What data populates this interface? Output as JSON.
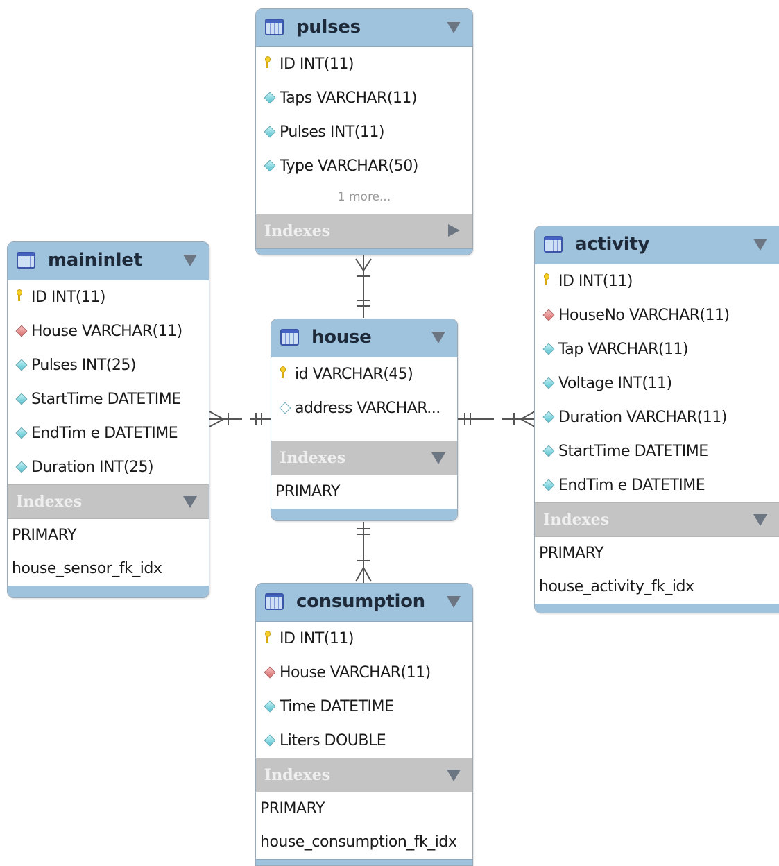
{
  "tables": {
    "pulses": {
      "name": "pulses",
      "columns": [
        {
          "text": "ID INT(11)",
          "icon": "primary-key-icon"
        },
        {
          "text": "Taps VARCHAR(11)",
          "icon": "column-diamond-icon"
        },
        {
          "text": "Pulses INT(11)",
          "icon": "column-diamond-icon"
        },
        {
          "text": "Type VARCHAR(50)",
          "icon": "column-diamond-icon"
        }
      ],
      "more": "1 more...",
      "indexes_label": "Indexes"
    },
    "maininlet": {
      "name": "maininlet",
      "columns": [
        {
          "text": "ID INT(11)",
          "icon": "primary-key-icon"
        },
        {
          "text": "House VARCHAR(11)",
          "icon": "foreign-key-diamond-icon"
        },
        {
          "text": "Pulses INT(25)",
          "icon": "column-diamond-icon"
        },
        {
          "text": "StartTime DATETIME",
          "icon": "column-diamond-icon"
        },
        {
          "text": "EndTim e DATETIME",
          "icon": "column-diamond-icon"
        },
        {
          "text": "Duration INT(25)",
          "icon": "column-diamond-icon"
        }
      ],
      "indexes_label": "Indexes",
      "indexes": [
        "PRIMARY",
        "house_sensor_fk_idx"
      ]
    },
    "house": {
      "name": "house",
      "columns": [
        {
          "text": "id VARCHAR(45)",
          "icon": "primary-key-icon"
        },
        {
          "text": "address VARCHAR...",
          "icon": "nullable-column-diamond-icon"
        }
      ],
      "indexes_label": "Indexes",
      "indexes": [
        "PRIMARY"
      ]
    },
    "activity": {
      "name": "activity",
      "columns": [
        {
          "text": "ID INT(11)",
          "icon": "primary-key-icon"
        },
        {
          "text": "HouseNo VARCHAR(11)",
          "icon": "foreign-key-diamond-icon"
        },
        {
          "text": "Tap VARCHAR(11)",
          "icon": "column-diamond-icon"
        },
        {
          "text": "Voltage INT(11)",
          "icon": "column-diamond-icon"
        },
        {
          "text": "Duration VARCHAR(11)",
          "icon": "column-diamond-icon"
        },
        {
          "text": "StartTime DATETIME",
          "icon": "column-diamond-icon"
        },
        {
          "text": "EndTim e DATETIME",
          "icon": "column-diamond-icon"
        }
      ],
      "indexes_label": "Indexes",
      "indexes": [
        "PRIMARY",
        "house_activity_fk_idx"
      ]
    },
    "consumption": {
      "name": "consumption",
      "columns": [
        {
          "text": "ID INT(11)",
          "icon": "primary-key-icon"
        },
        {
          "text": "House VARCHAR(11)",
          "icon": "foreign-key-diamond-icon"
        },
        {
          "text": "Time DATETIME",
          "icon": "column-diamond-icon"
        },
        {
          "text": "Liters DOUBLE",
          "icon": "column-diamond-icon"
        }
      ],
      "indexes_label": "Indexes",
      "indexes": [
        "PRIMARY",
        "house_consumption_fk_idx"
      ]
    }
  },
  "relationships": [
    {
      "from": "house",
      "to": "pulses",
      "cardinality": "one-to-many"
    },
    {
      "from": "house",
      "to": "maininlet",
      "cardinality": "one-to-many"
    },
    {
      "from": "house",
      "to": "activity",
      "cardinality": "one-to-many"
    },
    {
      "from": "house",
      "to": "consumption",
      "cardinality": "one-to-many"
    }
  ]
}
